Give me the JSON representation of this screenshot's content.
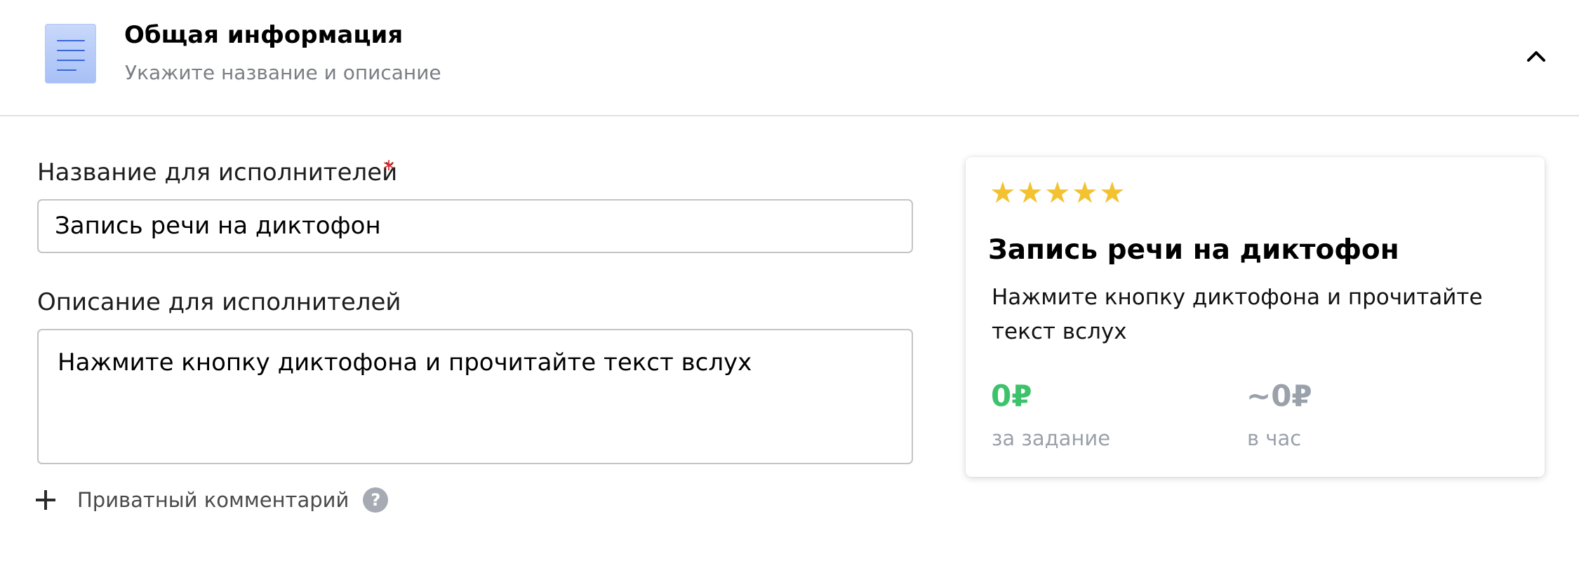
{
  "section": {
    "title": "Общая информация",
    "subtitle": "Укажите название и описание",
    "icon": "document-icon",
    "collapse_icon": "chevron-up-icon"
  },
  "form": {
    "name_label": "Название для исполнителей",
    "required_mark": "*",
    "name_value": "Запись речи на диктофон",
    "description_label": "Описание для исполнителей",
    "description_value": "Нажмите кнопку диктофона и прочитайте текст вслух",
    "private_comment_label": "Приватный комментарий",
    "help_mark": "?"
  },
  "preview": {
    "rating_stars": 5,
    "title": "Запись речи на диктофон",
    "description": "Нажмите кнопку диктофона и прочитайте текст вслух",
    "price_per_task": "0₽",
    "price_per_task_label": "за задание",
    "price_per_hour": "~0₽",
    "price_per_hour_label": "в час"
  },
  "colors": {
    "accent_green": "#3cc26b",
    "star": "#f2c230",
    "required": "#e0262b",
    "muted": "#9aa1ab"
  }
}
